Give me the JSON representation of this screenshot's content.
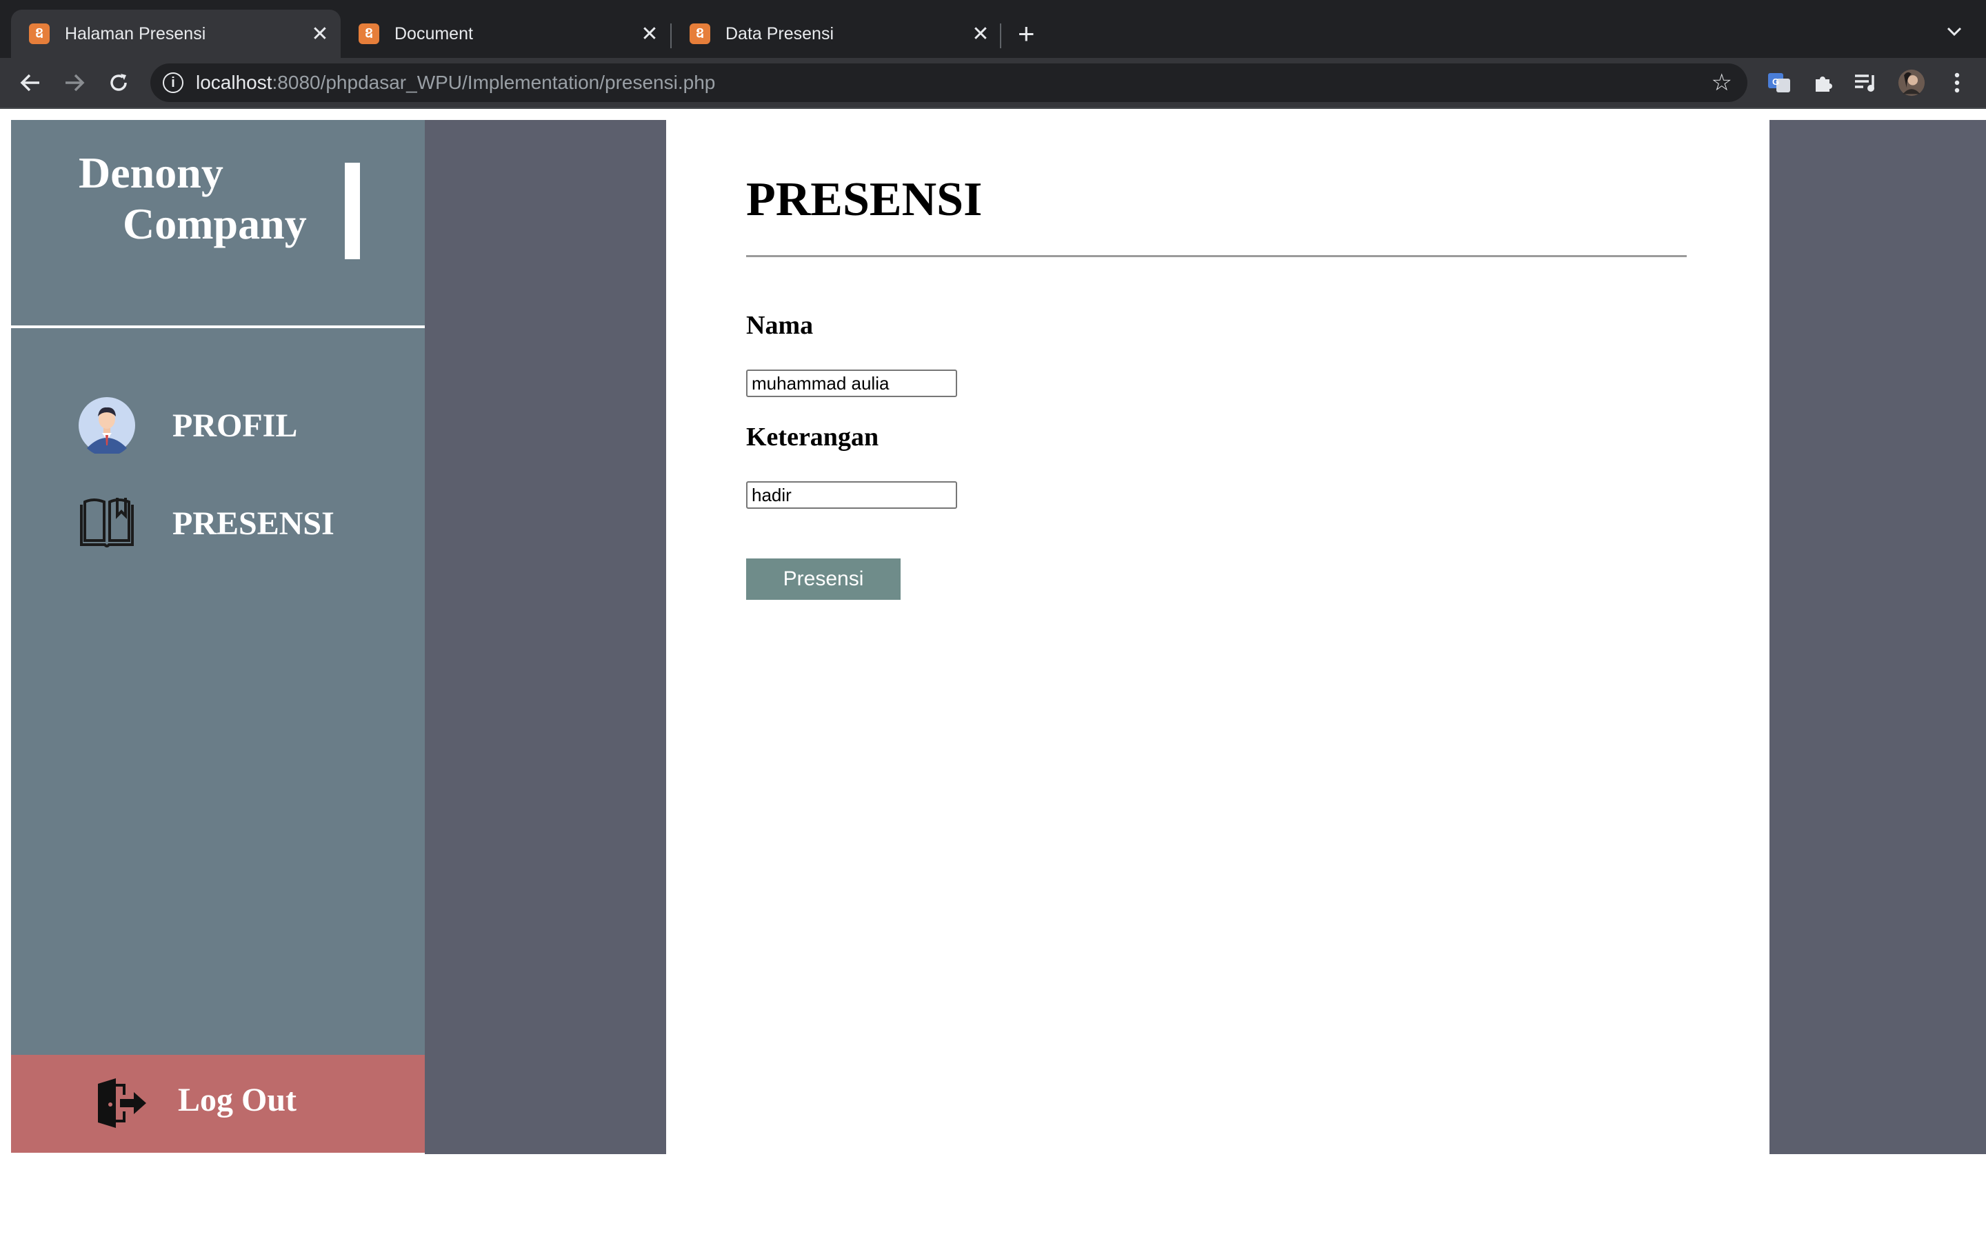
{
  "browser": {
    "tabs": [
      {
        "title": "Halaman Presensi",
        "active": true
      },
      {
        "title": "Document",
        "active": false
      },
      {
        "title": "Data Presensi",
        "active": false
      }
    ],
    "new_tab_icon": "+",
    "tab_menu_icon": "chevron-down-icon",
    "close_glyph": "✕",
    "url_host": "localhost",
    "url_path": ":8080/phpdasar_WPU/Implementation/presensi.php"
  },
  "sidebar": {
    "brand_line1": "Denony",
    "brand_line2": "Company",
    "nav": [
      {
        "label": "PROFIL",
        "icon": "user-avatar-icon"
      },
      {
        "label": "PRESENSI",
        "icon": "book-icon"
      }
    ],
    "logout_label": "Log Out",
    "logout_icon": "logout-door-icon"
  },
  "main": {
    "title": "PRESENSI",
    "nama_label": "Nama",
    "nama_value": "muhammad aulia",
    "keterangan_label": "Keterangan",
    "keterangan_value": "hadir",
    "submit_label": "Presensi"
  },
  "colors": {
    "sidebar": "#6a7d88",
    "gutter": "#5c5f6d",
    "logout": "#bd6b6b",
    "button": "#6f8c8a"
  }
}
